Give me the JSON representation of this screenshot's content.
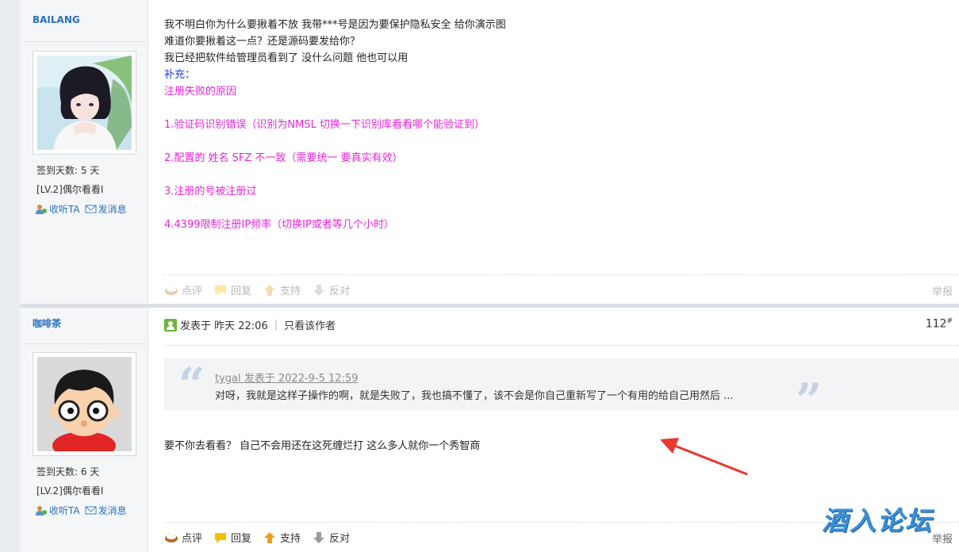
{
  "posts": [
    {
      "author": "BAILANG",
      "signin_days": "签到天数: 5 天",
      "level": "[LV.2]偶尔看看I",
      "follow_label": "收听TA",
      "message_label": "发消息",
      "lines_black": [
        "我不明白你为什么要揪着不放 我带***号是因为要保护隐私安全 给你演示图",
        "难道你要揪着这一点？还是源码要发给你？",
        "我已经把软件给管理员看到了 没什么问题 他也可以用"
      ],
      "supplement_label": "补充：",
      "lines_magenta": [
        "注册失败的原因",
        "1.验证码识别错误（识别为NMSL 切换一下识别库看看哪个能验证到）",
        "2.配置的 姓名 SFZ 不一致（需要统一 要真实有效）",
        "3.注册的号被注册过",
        "4.4399限制注册IP频率（切换IP或者等几个小时）"
      ],
      "footer": {
        "comment": "点评",
        "reply": "回复",
        "support": "支持",
        "oppose": "反对",
        "report": "举报"
      }
    },
    {
      "author": "咖啡茶",
      "signin_days": "签到天数: 6 天",
      "level": "[LV.2]偶尔看看I",
      "follow_label": "收听TA",
      "message_label": "发消息",
      "posted_at": "发表于 昨天 22:06",
      "only_author": "只看该作者",
      "floor": "112",
      "floor_mark": "#",
      "quote_author": "tygal 发表于 2022-9-5 12:59",
      "quote_text": "对呀，我就是这样子操作的啊，就是失败了，我也搞不懂了，该不会是你自己重新写了一个有用的给自己用然后 ...",
      "body": "要不你去看看？ 自己不会用还在这死缠烂打 这么多人就你一个秀智商",
      "footer": {
        "comment": "点评",
        "reply": "回复",
        "support": "支持",
        "oppose": "反对",
        "report": "举报"
      }
    }
  ],
  "watermark": "酒入论坛",
  "colors": {
    "link": "#2a6fbd",
    "magenta": "#e326d6",
    "arrow": "#e8382f",
    "topbar": "#4f7aa2"
  }
}
